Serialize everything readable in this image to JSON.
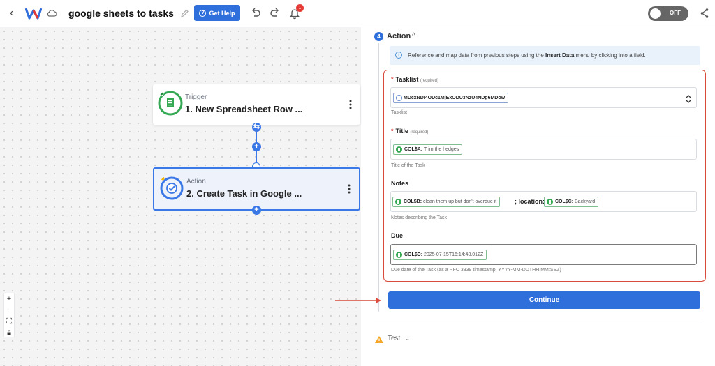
{
  "header": {
    "title": "google sheets to tasks",
    "help_label": "Get Help",
    "notification_count": "1",
    "toggle_label": "OFF",
    "brand_color": "#2f6fdc"
  },
  "canvas": {
    "trigger": {
      "kind": "Trigger",
      "name": "1. New Spreadsheet Row ..."
    },
    "action": {
      "kind": "Action",
      "name": "2. Create Task in Google ..."
    }
  },
  "panel": {
    "step_number": "4",
    "step_title": "Action",
    "info_prefix": "Reference and map data from previous steps using the ",
    "info_bold": "Insert Data",
    "info_suffix": " menu by clicking into a field.",
    "required_text": "(required)",
    "tasklist": {
      "label": "Tasklist",
      "value": "MDcxNDI4ODc1MjExODU3NzU4NDg6MDow",
      "help": "Tasklist"
    },
    "title_field": {
      "label": "Title",
      "pill_key": "COL$A:",
      "pill_value": "Trim the hedges",
      "help": "Title of the Task"
    },
    "notes": {
      "label": "Notes",
      "pill1_key": "COL$B:",
      "pill1_value": "clean them up but don't overdue it",
      "middle_text": "; location:",
      "pill2_key": "COL$C:",
      "pill2_value": "Backyard",
      "help": "Notes describing the Task"
    },
    "due": {
      "label": "Due",
      "pill_key": "COL$D:",
      "pill_value": "2025-07-15T16:14:48.012Z",
      "help": "Due date of the Task (as a RFC 3339 timestamp: YYYY-MM-DDTHH:MM:SSZ)"
    },
    "continue_label": "Continue",
    "test_label": "Test"
  }
}
